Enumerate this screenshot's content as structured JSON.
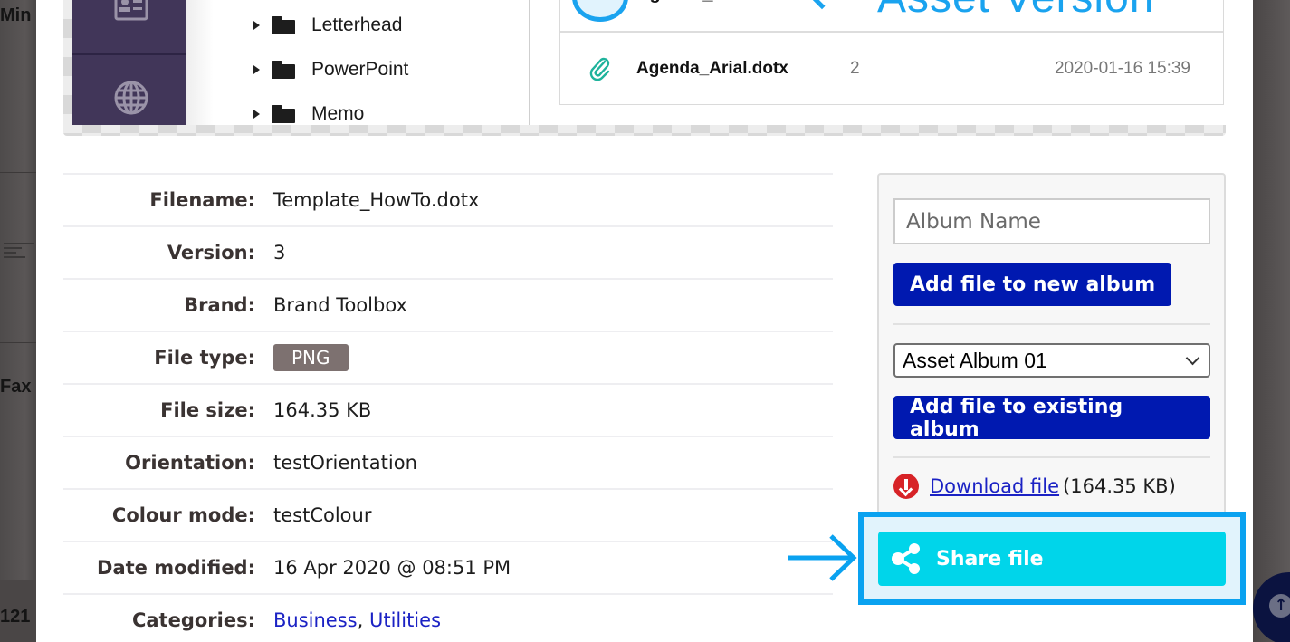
{
  "background": {
    "left_texts": [
      "Min",
      "Fax",
      "121"
    ]
  },
  "preview": {
    "folders": [
      {
        "label": "Letterhead"
      },
      {
        "label": "PowerPoint"
      },
      {
        "label": "Memo"
      }
    ],
    "annotation_title": "Asset Version",
    "highlighted_file": "Agenda_Arial.dotx",
    "file_row": {
      "name": "Agenda_Arial.dotx",
      "version": "2",
      "date": "2020-01-16 15:39"
    }
  },
  "details": {
    "rows": [
      {
        "key": "Filename:",
        "value": "Template_HowTo.dotx"
      },
      {
        "key": "Version:",
        "value": "3"
      },
      {
        "key": "Brand:",
        "value": "Brand Toolbox"
      },
      {
        "key": "File type:",
        "value": "PNG"
      },
      {
        "key": "File size:",
        "value": "164.35 KB"
      },
      {
        "key": "Orientation:",
        "value": "testOrientation"
      },
      {
        "key": "Colour mode:",
        "value": "testColour"
      },
      {
        "key": "Date modified:",
        "value": "16 Apr 2020 @ 08:51 PM"
      },
      {
        "key": "Categories:",
        "categories": [
          "Business",
          "Utilities"
        ],
        "separator": ", "
      }
    ]
  },
  "album_panel": {
    "album_name_placeholder": "Album Name",
    "add_new_label": "Add file to new album",
    "selected_album": "Asset Album 01",
    "add_existing_label": "Add file to existing album",
    "download_label": "Download file",
    "download_size": "(164.35 KB)",
    "share_label": "Share file"
  },
  "colors": {
    "primary_button": "#0019b0",
    "share_button": "#00d5ea",
    "highlight": "#0aa2f0",
    "link": "#1b22c4",
    "badge": "#7d7170",
    "sidebar": "#413659"
  }
}
